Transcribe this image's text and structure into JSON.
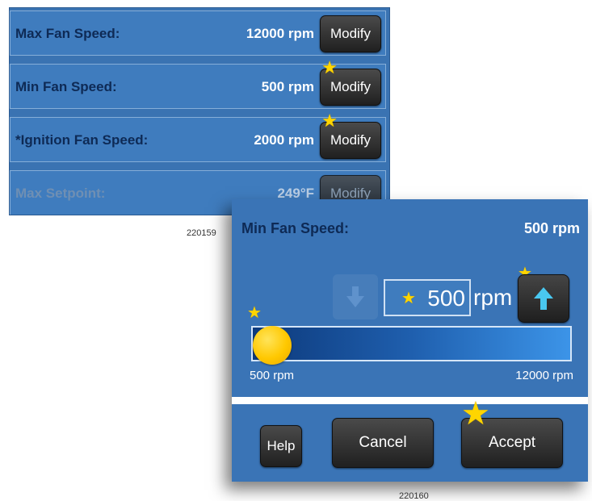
{
  "settings_list": {
    "rows": [
      {
        "label": "Max Fan Speed:",
        "value": "12000 rpm",
        "button": "Modify"
      },
      {
        "label": "Min Fan Speed:",
        "value": "500 rpm",
        "button": "Modify"
      },
      {
        "label": "*Ignition Fan Speed:",
        "value": "2000 rpm",
        "button": "Modify"
      },
      {
        "label": "Max Setpoint:",
        "value": "249°F",
        "button": "Modify"
      }
    ],
    "caption": "220159"
  },
  "dialog": {
    "title": "Min Fan Speed:",
    "current_value": "500 rpm",
    "input_value": "500",
    "unit": "rpm",
    "slider": {
      "min_label": "500 rpm",
      "max_label": "12000 rpm",
      "level": 0.0
    },
    "buttons": {
      "help": "Help",
      "cancel": "Cancel",
      "accept": "Accept"
    },
    "caption": "220160"
  },
  "icons": {
    "star": "★",
    "up_arrow": "arrow-up-icon",
    "down_arrow": "arrow-down-icon"
  },
  "colors": {
    "panel_blue": "#3a74b6",
    "row_blue": "#3f7cbe",
    "star_yellow": "#ffd500",
    "knob_yellow": "#ffc800",
    "label_navy": "#0e2a55"
  }
}
